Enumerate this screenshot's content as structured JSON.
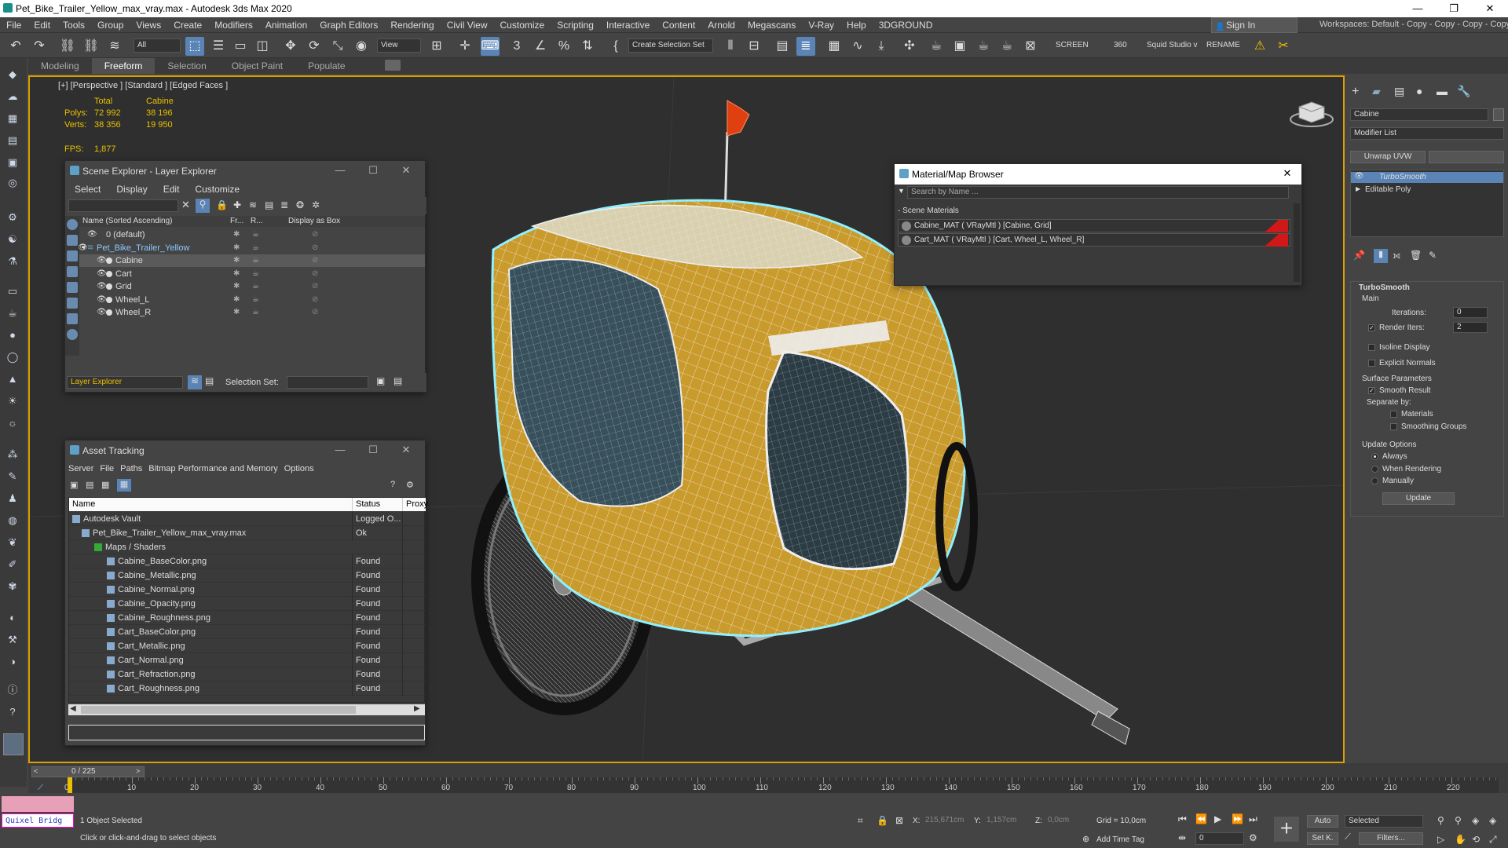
{
  "title": "Pet_Bike_Trailer_Yellow_max_vray.max - Autodesk 3ds Max 2020",
  "menu": [
    "File",
    "Edit",
    "Tools",
    "Group",
    "Views",
    "Create",
    "Modifiers",
    "Animation",
    "Graph Editors",
    "Rendering",
    "Civil View",
    "Customize",
    "Scripting",
    "Interactive",
    "Content",
    "Arnold",
    "Megascans",
    "V-Ray",
    "Help",
    "3DGROUND"
  ],
  "signin": "Sign In",
  "workspaces": "Workspaces:  Default - Copy - Copy - Copy - Copy",
  "toolbar": {
    "filter": "All",
    "view": "View",
    "create_sel": "Create Selection Set",
    "screen": "SCREEN",
    "num360": "360",
    "squid": "Squid Studio v",
    "rename": "RENAME"
  },
  "ribbon": [
    "Modeling",
    "Freeform",
    "Selection",
    "Object Paint",
    "Populate"
  ],
  "viewport": {
    "label": "[+] [Perspective ] [Standard ] [Edged Faces ]",
    "total": "Total",
    "cabine": "Cabine",
    "polys_l": "Polys:",
    "polys_t": "72 992",
    "polys_c": "38 196",
    "verts_l": "Verts:",
    "verts_t": "38 356",
    "verts_c": "19 950",
    "fps_l": "FPS:",
    "fps_v": "1,877"
  },
  "scene_explorer": {
    "title": "Scene Explorer - Layer Explorer",
    "menu": [
      "Select",
      "Display",
      "Edit",
      "Customize"
    ],
    "col_name": "Name (Sorted Ascending)",
    "col_fr": "Fr...",
    "col_r": "R...",
    "col_box": "Display as Box",
    "rows": [
      "0 (default)",
      "Pet_Bike_Trailer_Yellow",
      "Cabine",
      "Cart",
      "Grid",
      "Wheel_L",
      "Wheel_R"
    ],
    "footer": "Layer Explorer",
    "selset": "Selection Set:"
  },
  "asset": {
    "title": "Asset Tracking",
    "menu": [
      "Server",
      "File",
      "Paths",
      "Bitmap Performance and Memory",
      "Options"
    ],
    "col_name": "Name",
    "col_status": "Status",
    "col_proxy": "Proxy",
    "rows": [
      {
        "n": "Autodesk Vault",
        "s": "Logged O..."
      },
      {
        "n": "Pet_Bike_Trailer_Yellow_max_vray.max",
        "s": "Ok"
      },
      {
        "n": "Maps / Shaders",
        "s": ""
      },
      {
        "n": "Cabine_BaseColor.png",
        "s": "Found"
      },
      {
        "n": "Cabine_Metallic.png",
        "s": "Found"
      },
      {
        "n": "Cabine_Normal.png",
        "s": "Found"
      },
      {
        "n": "Cabine_Opacity.png",
        "s": "Found"
      },
      {
        "n": "Cabine_Roughness.png",
        "s": "Found"
      },
      {
        "n": "Cart_BaseColor.png",
        "s": "Found"
      },
      {
        "n": "Cart_Metallic.png",
        "s": "Found"
      },
      {
        "n": "Cart_Normal.png",
        "s": "Found"
      },
      {
        "n": "Cart_Refraction.png",
        "s": "Found"
      },
      {
        "n": "Cart_Roughness.png",
        "s": "Found"
      }
    ]
  },
  "mmb": {
    "title": "Material/Map Browser",
    "search": "Search by Name ...",
    "section": "- Scene Materials",
    "rows": [
      "Cabine_MAT  ( VRayMtl )  [Cabine, Grid]",
      "Cart_MAT  ( VRayMtl )  [Cart, Wheel_L, Wheel_R]"
    ]
  },
  "cmd": {
    "object": "Cabine",
    "modlist": "Modifier List",
    "unwrap": "Unwrap UVW",
    "stack": [
      "TurboSmooth",
      "Editable Poly"
    ],
    "ts": "TurboSmooth",
    "main": "Main",
    "iter_l": "Iterations:",
    "iter_v": "0",
    "render_l": "Render Iters:",
    "render_v": "2",
    "isoline": "Isoline Display",
    "explicit": "Explicit Normals",
    "surface": "Surface Parameters",
    "smooth": "Smooth Result",
    "sepby": "Separate by:",
    "materials": "Materials",
    "sgroups": "Smoothing Groups",
    "update_opts": "Update Options",
    "always": "Always",
    "whenr": "When Rendering",
    "manually": "Manually",
    "update": "Update"
  },
  "timeline": {
    "frame": "0 / 225",
    "ticks": [
      "0",
      "10",
      "20",
      "30",
      "40",
      "50",
      "60",
      "70",
      "80",
      "90",
      "100",
      "110",
      "120",
      "130",
      "140",
      "150",
      "160",
      "170",
      "180",
      "190",
      "200",
      "210",
      "220"
    ]
  },
  "status": {
    "quixel": "Quixel Bridg",
    "selected": "1 Object Selected",
    "hint": "Click or click-and-drag to select objects",
    "x_l": "X:",
    "x_v": "215,671cm",
    "y_l": "Y:",
    "y_v": "1,157cm",
    "z_l": "Z:",
    "z_v": "0,0cm",
    "grid": "Grid = 10,0cm",
    "addtag": "Add Time Tag",
    "auto": "Auto",
    "selected_dd": "Selected",
    "setk": "Set K.",
    "filters": "Filters...",
    "frame0": "0"
  }
}
